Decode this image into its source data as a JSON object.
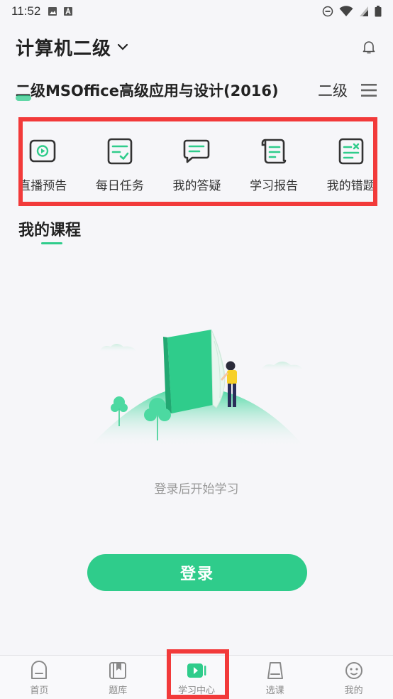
{
  "status_bar": {
    "time": "11:52"
  },
  "header": {
    "title": "计算机二级"
  },
  "course": {
    "name": "二级MSOffice高级应用与设计(2016)",
    "level": "二级"
  },
  "quick_actions": [
    {
      "label": "直播预告",
      "icon": "live-preview-icon"
    },
    {
      "label": "每日任务",
      "icon": "daily-task-icon"
    },
    {
      "label": "我的答疑",
      "icon": "qa-icon"
    },
    {
      "label": "学习报告",
      "icon": "report-icon"
    },
    {
      "label": "我的错题",
      "icon": "mistakes-icon"
    }
  ],
  "section": {
    "title": "我的课程"
  },
  "empty_state": {
    "hint": "登录后开始学习"
  },
  "login_button": {
    "label": "登录"
  },
  "bottom_nav": [
    {
      "label": "首页",
      "icon": "home-icon"
    },
    {
      "label": "题库",
      "icon": "question-bank-icon"
    },
    {
      "label": "学习中心",
      "icon": "study-center-icon",
      "active": true
    },
    {
      "label": "选课",
      "icon": "course-select-icon"
    },
    {
      "label": "我的",
      "icon": "profile-icon"
    }
  ],
  "colors": {
    "accent": "#2fcc8b",
    "highlight": "#f23a3a"
  }
}
